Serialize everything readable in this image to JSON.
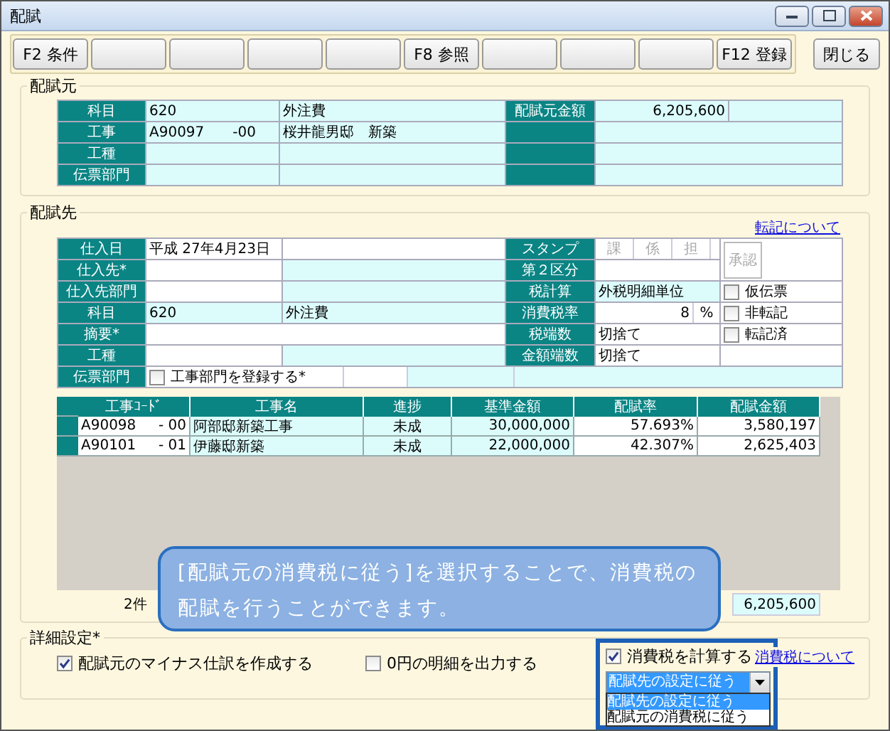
{
  "window": {
    "title": "配賦"
  },
  "toolbar": [
    {
      "kind": "key",
      "label": "F2 条件"
    },
    {
      "kind": "blank"
    },
    {
      "kind": "blank"
    },
    {
      "kind": "blank"
    },
    {
      "kind": "blank"
    },
    {
      "kind": "key",
      "label": "F8 参照"
    },
    {
      "kind": "blank"
    },
    {
      "kind": "blank"
    },
    {
      "kind": "blank"
    },
    {
      "kind": "key",
      "label": "F12 登録"
    }
  ],
  "close_button": "閉じる",
  "source": {
    "title": "配賦元",
    "rows": [
      {
        "label": "科目",
        "code": "620",
        "name": "外注費",
        "label_2": "配賦元金額",
        "value": "6,205,600"
      },
      {
        "label": "工事",
        "code": "A90097　　-00",
        "name": "桜井龍男邸　新築"
      },
      {
        "label": "工種"
      },
      {
        "label": "伝票部門"
      }
    ]
  },
  "destination": {
    "title": "配賦先",
    "link": "転記について",
    "fields": [
      {
        "label": "仕入日",
        "value": "平成 27年4月23日"
      },
      {
        "label": "仕入先*"
      },
      {
        "label": "仕入先部門"
      },
      {
        "label": "科目",
        "code": "620",
        "name": "外注費"
      },
      {
        "label": "摘要*"
      },
      {
        "label": "工種"
      },
      {
        "label": "伝票部門",
        "checkbox": {
          "label": "工事部門を登録する*",
          "checked": false
        }
      }
    ],
    "stamp": {
      "label": "スタンプ",
      "slots": [
        "課",
        "係",
        "担"
      ],
      "approve": "承認"
    },
    "right_fields": [
      {
        "label": "第２区分"
      },
      {
        "label": "税計算",
        "value": "外税明細単位"
      },
      {
        "label": "消費税率",
        "value": "8",
        "unit": "%"
      },
      {
        "label": "税端数",
        "value": "切捨て"
      },
      {
        "label": "金額端数",
        "value": "切捨て"
      }
    ],
    "flags": [
      {
        "label": "仮伝票",
        "checked": false
      },
      {
        "label": "非転記",
        "checked": false
      },
      {
        "label": "転記済",
        "checked": false
      }
    ],
    "table": {
      "columns": [
        "工事ｺｰﾄﾞ",
        "工事名",
        "進捗",
        "基準金額",
        "配賦率",
        "配賦金額"
      ],
      "rows": [
        {
          "code": "A90098",
          "branch": "- 00",
          "name": "阿部邸新築工事",
          "progress": "未成",
          "base": "30,000,000",
          "rate": "57.693%",
          "amount": "3,580,197"
        },
        {
          "code": "A90101",
          "branch": "- 01",
          "name": "伊藤邸新築",
          "progress": "未成",
          "base": "22,000,000",
          "rate": "42.307%",
          "amount": "2,625,403"
        }
      ]
    },
    "count": "2件",
    "total": "6,205,600"
  },
  "callout": "[配賦元の消費税に従う]を選択することで、消費税の配賦を行うことができます。",
  "details": {
    "title": "詳細設定*",
    "options": [
      {
        "label": "配賦元のマイナス仕訳を作成する",
        "checked": true
      },
      {
        "label": "0円の明細を出力する",
        "checked": false
      }
    ],
    "tax": {
      "label": "消費税を計算する",
      "checked": true,
      "select_value": "配賦先の設定に従う",
      "options": [
        {
          "label": "配賦先の設定に従う",
          "selected": true
        },
        {
          "label": "配賦元の消費税に従う",
          "selected": false
        }
      ]
    },
    "link": "消費税について"
  }
}
